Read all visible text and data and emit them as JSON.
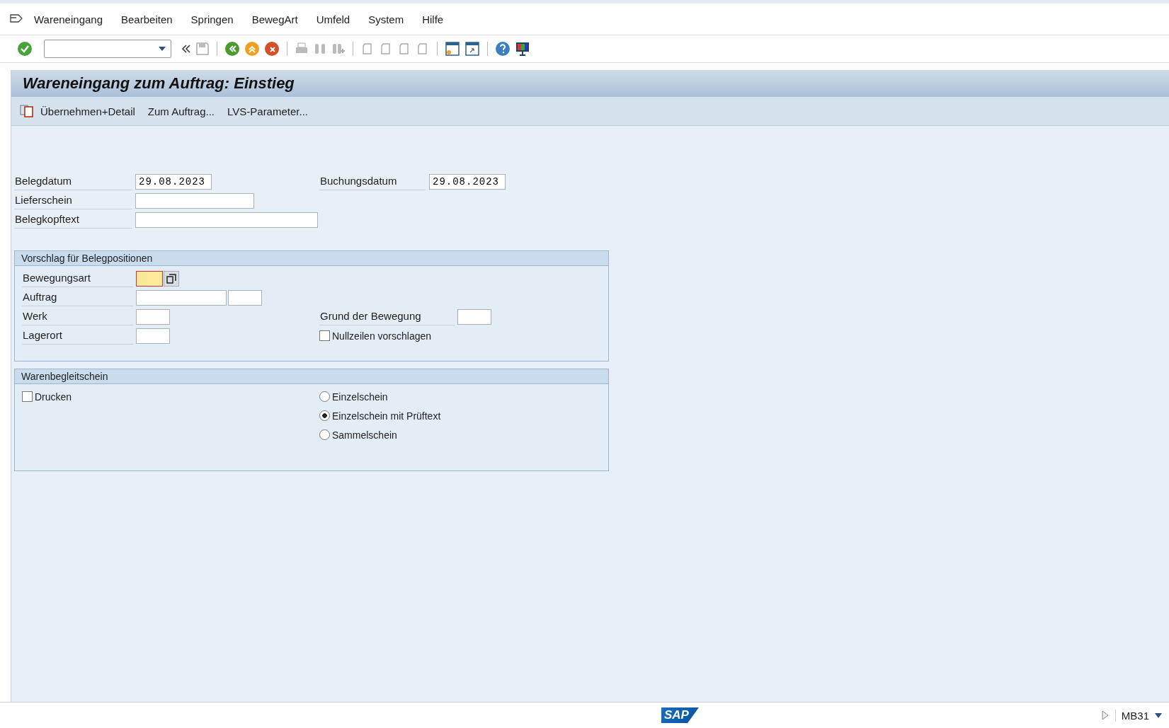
{
  "menu": [
    {
      "label": "Wareneingang"
    },
    {
      "label": "Bearbeiten"
    },
    {
      "label": "Springen"
    },
    {
      "label": "BewegArt"
    },
    {
      "label": "Umfeld"
    },
    {
      "label": "System"
    },
    {
      "label": "Hilfe"
    }
  ],
  "title": "Wareneingang zum Auftrag: Einstieg",
  "app_toolbar": [
    {
      "label": "Übernehmen+Detail",
      "kind": "icon"
    },
    {
      "label": "Zum Auftrag...",
      "kind": "plain"
    },
    {
      "label": "LVS-Parameter...",
      "kind": "plain"
    }
  ],
  "header_fields": {
    "left": [
      {
        "label": "Belegdatum",
        "value": "29.08.2023"
      },
      {
        "label": "Lieferschein"
      },
      {
        "label": "Belegkopftext"
      }
    ],
    "right": [
      {
        "label": "Buchungsdatum",
        "value": "29.08.2023"
      }
    ]
  },
  "groups": [
    {
      "title": "Vorschlag für Belegpositionen",
      "left": [
        {
          "kind": "field",
          "label": "Bewegungsart",
          "focused": true,
          "help": true
        },
        {
          "kind": "double_field",
          "label": "Auftrag",
          "focused": false,
          "help": false
        },
        {
          "kind": "field",
          "label": "Werk",
          "focused": false,
          "help": false
        },
        {
          "kind": "field",
          "label": "Lagerort",
          "focused": false,
          "help": false
        }
      ],
      "right": [
        {
          "kind": "field",
          "label": "Grund der Bewegung",
          "focused": false,
          "help": false
        },
        {
          "kind": "checkbox",
          "label": "Nullzeilen vorschlagen",
          "checked": false
        }
      ]
    },
    {
      "title": "Warenbegleitschein",
      "left": [
        {
          "kind": "checkbox",
          "label": "Drucken",
          "checked": false
        }
      ],
      "right": [
        {
          "kind": "radio",
          "label": "Einzelschein",
          "selected": false
        },
        {
          "kind": "radio",
          "label": "Einzelschein mit Prüftext",
          "selected": true
        },
        {
          "kind": "radio",
          "label": "Sammelschein",
          "selected": false
        }
      ]
    }
  ],
  "status_bar": {
    "logo": "SAP",
    "transaction": "MB31"
  }
}
